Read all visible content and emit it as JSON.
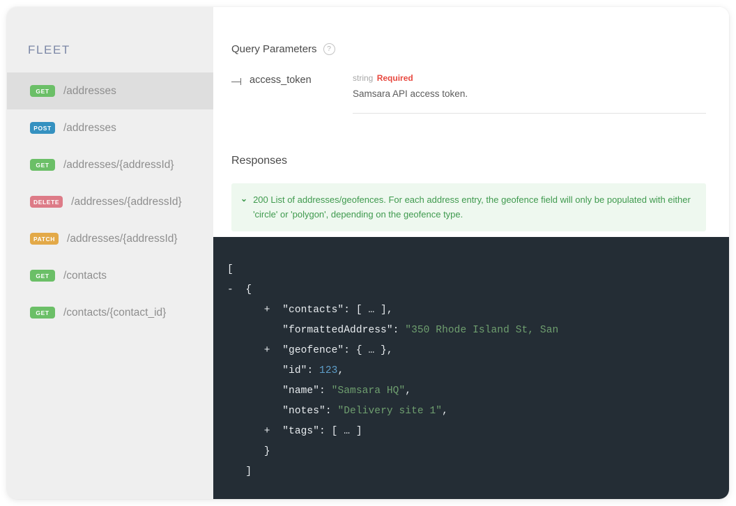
{
  "sidebar": {
    "title": "FLEET",
    "items": [
      {
        "method": "GET",
        "path": "/addresses",
        "active": true
      },
      {
        "method": "POST",
        "path": "/addresses",
        "active": false
      },
      {
        "method": "GET",
        "path": "/addresses/{addressId}",
        "active": false
      },
      {
        "method": "DELETE",
        "path": "/addresses/{addressId}",
        "active": false
      },
      {
        "method": "PATCH",
        "path": "/addresses/{addressId}",
        "active": false
      },
      {
        "method": "GET",
        "path": "/contacts",
        "active": false
      },
      {
        "method": "GET",
        "path": "/contacts/{contact_id}",
        "active": false
      }
    ]
  },
  "query_parameters": {
    "heading": "Query Parameters",
    "help_icon": "question-mark-icon",
    "parameters": [
      {
        "name": "access_token",
        "type": "string",
        "required_label": "Required",
        "description": "Samsara API access token."
      }
    ]
  },
  "responses": {
    "heading": "Responses",
    "items": [
      {
        "chevron": "chevron-down-icon",
        "text": "200 List of addresses/geofences. For each address entry, the geofence field will only be populated with either 'circle' or 'polygon', depending on the geofence type."
      }
    ]
  },
  "code_sample": {
    "language": "json",
    "lines": [
      {
        "indent": 0,
        "fold": "",
        "tokens": [
          {
            "t": "[",
            "c": "punct"
          }
        ]
      },
      {
        "indent": 1,
        "fold": "-",
        "tokens": [
          {
            "t": "{",
            "c": "punct"
          }
        ]
      },
      {
        "indent": 3,
        "fold": "+",
        "tokens": [
          {
            "t": "\"contacts\"",
            "c": "key"
          },
          {
            "t": ": [ … ],",
            "c": "punct"
          }
        ]
      },
      {
        "indent": 3,
        "fold": "",
        "tokens": [
          {
            "t": "\"formattedAddress\"",
            "c": "key"
          },
          {
            "t": ": ",
            "c": "punct"
          },
          {
            "t": "\"350 Rhode Island St, San",
            "c": "str"
          }
        ]
      },
      {
        "indent": 3,
        "fold": "+",
        "tokens": [
          {
            "t": "\"geofence\"",
            "c": "key"
          },
          {
            "t": ": { … },",
            "c": "punct"
          }
        ]
      },
      {
        "indent": 3,
        "fold": "",
        "tokens": [
          {
            "t": "\"id\"",
            "c": "key"
          },
          {
            "t": ": ",
            "c": "punct"
          },
          {
            "t": "123",
            "c": "num"
          },
          {
            "t": ",",
            "c": "punct"
          }
        ]
      },
      {
        "indent": 3,
        "fold": "",
        "tokens": [
          {
            "t": "\"name\"",
            "c": "key"
          },
          {
            "t": ": ",
            "c": "punct"
          },
          {
            "t": "\"Samsara HQ\"",
            "c": "str"
          },
          {
            "t": ",",
            "c": "punct"
          }
        ]
      },
      {
        "indent": 3,
        "fold": "",
        "tokens": [
          {
            "t": "\"notes\"",
            "c": "key"
          },
          {
            "t": ": ",
            "c": "punct"
          },
          {
            "t": "\"Delivery site 1\"",
            "c": "str"
          },
          {
            "t": ",",
            "c": "punct"
          }
        ]
      },
      {
        "indent": 3,
        "fold": "+",
        "tokens": [
          {
            "t": "\"tags\"",
            "c": "key"
          },
          {
            "t": ": [ … ]",
            "c": "punct"
          }
        ]
      },
      {
        "indent": 2,
        "fold": "",
        "tokens": [
          {
            "t": "}",
            "c": "punct"
          }
        ]
      },
      {
        "indent": 1,
        "fold": "",
        "tokens": [
          {
            "t": "]",
            "c": "punct"
          }
        ]
      }
    ]
  },
  "colors": {
    "method_get": "#6bbf67",
    "method_post": "#3591c0",
    "method_delete": "#dd7b87",
    "method_patch": "#e3a948",
    "sidebar_bg": "#efefef",
    "sidebar_active_bg": "#dedede",
    "sidebar_title": "#7c87a6",
    "response_success": "#3f9a4e",
    "response_banner_bg": "#eef8ef",
    "required_red": "#e8483f",
    "code_bg": "#242d35"
  }
}
